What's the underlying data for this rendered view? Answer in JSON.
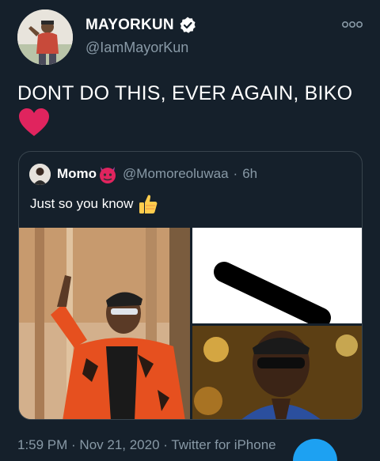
{
  "author": {
    "display_name": "MAYORKUN",
    "handle": "@IamMayorKun",
    "verified": true,
    "avatar_icon": "profile-photo"
  },
  "tweet": {
    "text": "DONT DO THIS, EVER AGAIN, BIKO",
    "emoji": "red-heart"
  },
  "quoted_tweet": {
    "display_name": "Momo",
    "name_emoji": "devil-face",
    "handle": "@Momoreoluwaa",
    "separator": "·",
    "time": "6h",
    "text": "Just so you know",
    "text_emoji": "thumbs-up",
    "media_count": 3
  },
  "footer": {
    "timestamp": "1:59 PM · Nov 21, 2020 · Twitter for iPhone"
  },
  "colors": {
    "background": "#15202b",
    "secondary_text": "#8899a6",
    "border": "#38444d",
    "accent": "#1da1f2",
    "heart": "#e0245e"
  }
}
